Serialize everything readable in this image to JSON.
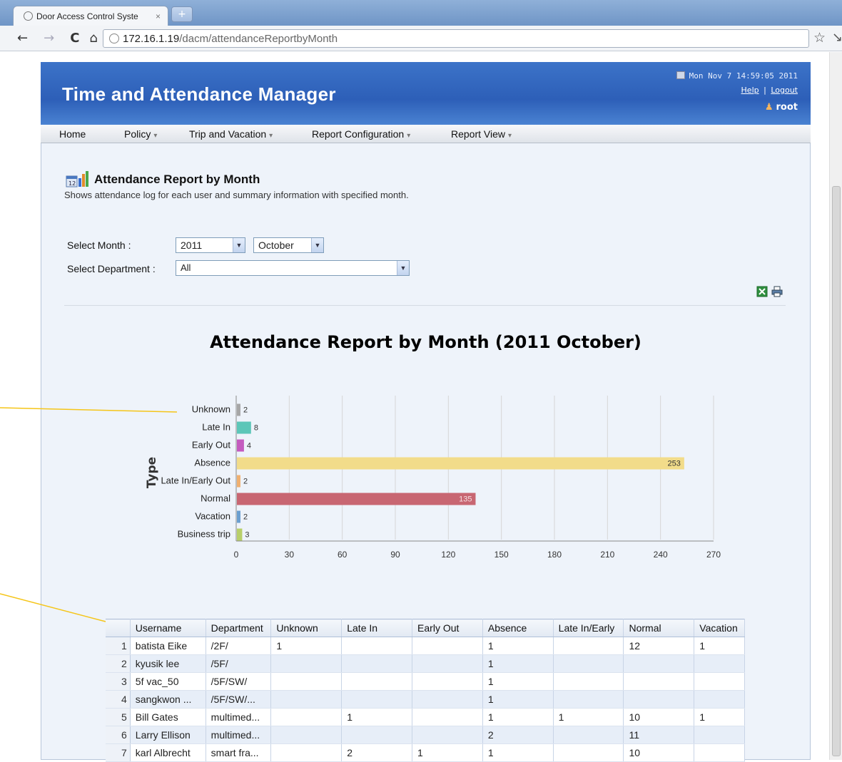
{
  "browser": {
    "tab_title": "Door Access Control Syste",
    "tab_close": "×",
    "new_tab": "+",
    "url_host": "172.16.1.19",
    "url_path": "/dacm/attendanceReportbyMonth",
    "icons": [
      "back-arrow-icon",
      "forward-arrow-icon",
      "reload-icon",
      "home-icon",
      "globe-icon",
      "star-icon",
      "wrench-icon"
    ]
  },
  "header": {
    "title": "Time and Attendance Manager",
    "datetime": "Mon Nov 7 14:59:05 2011",
    "help": "Help",
    "sep": "|",
    "logout": "Logout",
    "user": "root"
  },
  "menu": {
    "home": "Home",
    "policy": "Policy",
    "trip": "Trip and Vacation",
    "report_config": "Report Configuration",
    "report_view": "Report View"
  },
  "page": {
    "title": "Attendance Report by Month",
    "description": "Shows attendance log for each user and summary information with specified month."
  },
  "filters": {
    "month_label": "Select Month :",
    "year": "2011",
    "month": "October",
    "dept_label": "Select Department :",
    "department": "All"
  },
  "chart_title": "Attendance Report by Month (2011 October)",
  "chart_data": {
    "type": "bar",
    "orientation": "horizontal",
    "ylabel": "Type",
    "categories": [
      "Unknown",
      "Late In",
      "Early Out",
      "Absence",
      "Late In/Early Out",
      "Normal",
      "Vacation",
      "Business trip"
    ],
    "values": [
      2,
      8,
      4,
      253,
      2,
      135,
      2,
      3
    ],
    "colors": [
      "#a6a6a6",
      "#5cc6b8",
      "#c45bbf",
      "#f2dc8a",
      "#f0b070",
      "#c86672",
      "#6a9fd0",
      "#b8cf6a"
    ],
    "xlim": [
      0,
      270
    ],
    "xticks": [
      "0",
      "30",
      "60",
      "90",
      "120",
      "150",
      "180",
      "210",
      "240",
      "270"
    ],
    "grid": true
  },
  "table": {
    "columns": [
      "Username",
      "Department",
      "Unknown",
      "Late In",
      "Early Out",
      "Absence",
      "Late In/Early",
      "Normal",
      "Vacation"
    ],
    "rows": [
      [
        "1",
        "batista Eike",
        "/2F/",
        "1",
        "",
        "",
        "1",
        "",
        "12",
        "1"
      ],
      [
        "2",
        "kyusik lee",
        "/5F/",
        "",
        "",
        "",
        "1",
        "",
        "",
        ""
      ],
      [
        "3",
        "5f vac_50",
        "/5F/SW/",
        "",
        "",
        "",
        "1",
        "",
        "",
        ""
      ],
      [
        "4",
        "sangkwon ...",
        "/5F/SW/...",
        "",
        "",
        "",
        "1",
        "",
        "",
        ""
      ],
      [
        "5",
        "Bill Gates",
        "multimed...",
        "",
        "1",
        "",
        "1",
        "1",
        "10",
        "1"
      ],
      [
        "6",
        "Larry Ellison",
        "multimed...",
        "",
        "",
        "",
        "2",
        "",
        "11",
        ""
      ],
      [
        "7",
        "karl Albrecht",
        "smart fra...",
        "",
        "2",
        "1",
        "1",
        "",
        "10",
        ""
      ]
    ]
  }
}
